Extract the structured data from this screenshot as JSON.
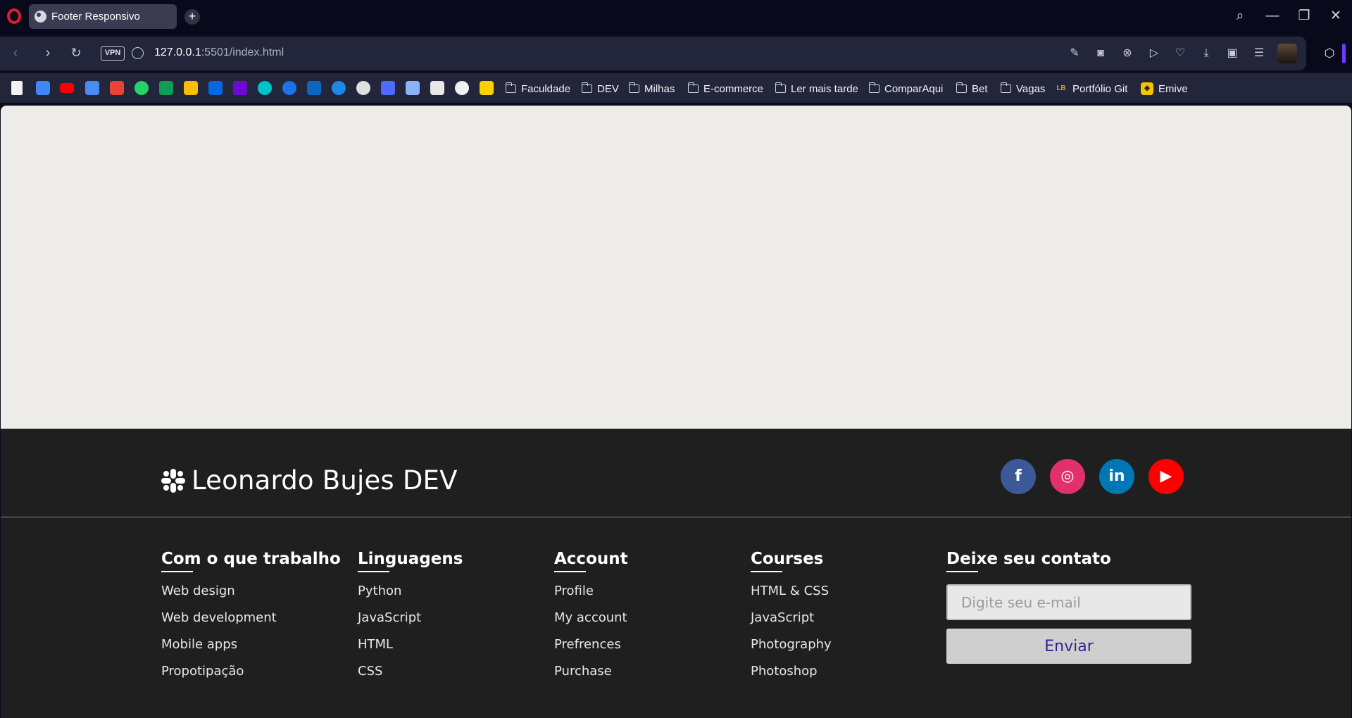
{
  "browser": {
    "tab_title": "Footer Responsivo",
    "new_tab_label": "+",
    "url_host": "127.0.0.1",
    "url_path": ":5501/index.html",
    "vpn_label": "VPN",
    "bookmark_folders": [
      "Faculdade",
      "DEV",
      "Milhas",
      "E-commerce",
      "Ler mais tarde",
      "ComparAqui",
      "Bet",
      "Vagas"
    ],
    "bookmark_links": [
      "Portfólio Git",
      "Emive"
    ],
    "bookmark_link_badges": [
      "LB",
      "◈"
    ],
    "accent_color": "#6b3cff"
  },
  "footer": {
    "brand": "Leonardo Bujes DEV",
    "socials": [
      {
        "name": "facebook",
        "glyph": "f",
        "color": "#3b5998"
      },
      {
        "name": "instagram",
        "glyph": "◎",
        "color": "#e1306c"
      },
      {
        "name": "linkedin",
        "glyph": "in",
        "color": "#0077b5"
      },
      {
        "name": "youtube",
        "glyph": "▶",
        "color": "#ff0000"
      }
    ],
    "columns": [
      {
        "title": "Com o que trabalho",
        "items": [
          "Web design",
          "Web development",
          "Mobile apps",
          "Propotipação"
        ]
      },
      {
        "title": "Linguagens",
        "items": [
          "Python",
          "JavaScript",
          "HTML",
          "CSS"
        ]
      },
      {
        "title": "Account",
        "items": [
          "Profile",
          "My account",
          "Prefrences",
          "Purchase"
        ]
      },
      {
        "title": "Courses",
        "items": [
          "HTML & CSS",
          "JavaScript",
          "Photography",
          "Photoshop"
        ]
      }
    ],
    "contact": {
      "title": "Deixe seu contato",
      "email_placeholder": "Digite seu e-mail",
      "submit_label": "Enviar"
    }
  }
}
